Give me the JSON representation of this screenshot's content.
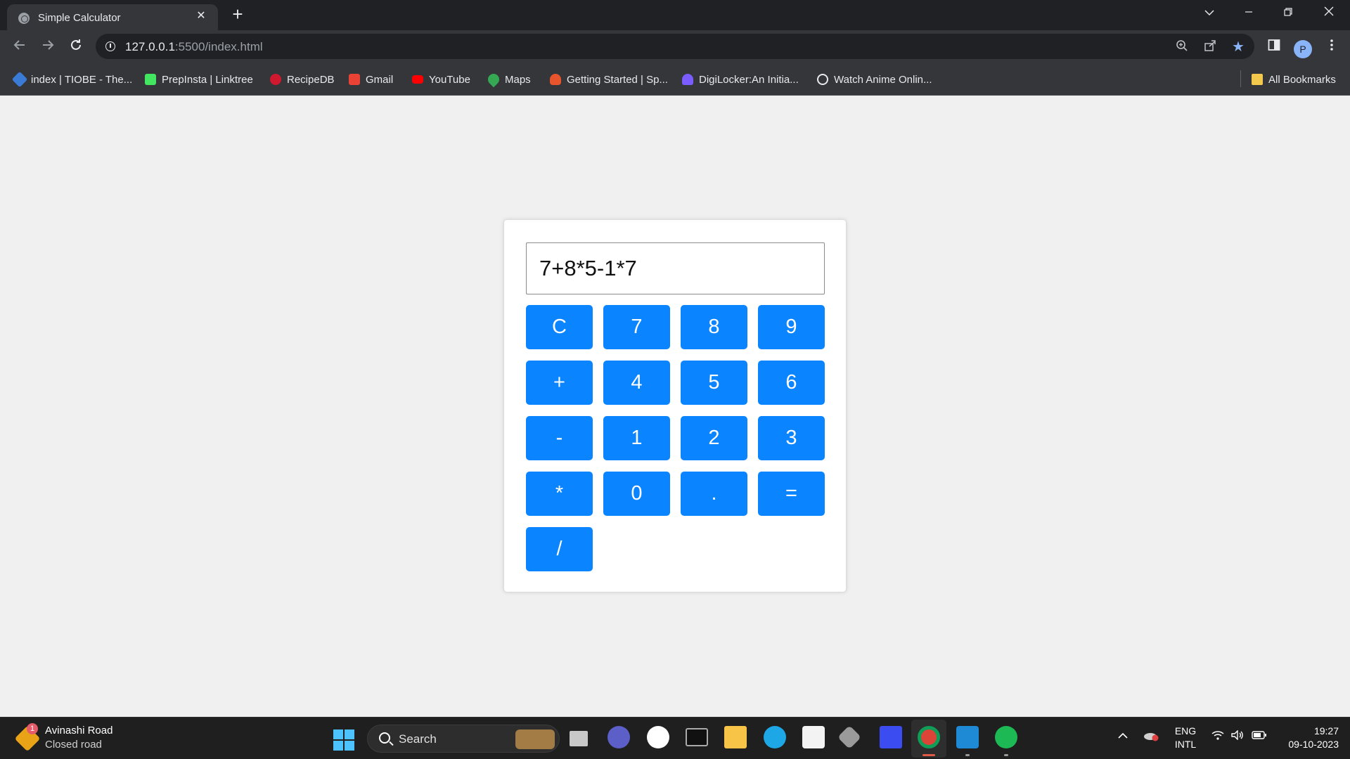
{
  "browser": {
    "tab_title": "Simple Calculator",
    "tab_close": "✕",
    "new_tab": "+",
    "url_host": "127.0.0.1",
    "url_path": ":5500/index.html",
    "profile_initial": "P"
  },
  "bookmarks": [
    {
      "label": "index | TIOBE - The...",
      "icon": "tiobe-icon",
      "color": "#3a7bd5"
    },
    {
      "label": "PrepInsta | Linktree",
      "icon": "linktree-icon",
      "color": "#43e660"
    },
    {
      "label": "RecipeDB",
      "icon": "recipedb-icon",
      "color": "#d0182e"
    },
    {
      "label": "Gmail",
      "icon": "gmail-icon",
      "color": "#ea4335"
    },
    {
      "label": "YouTube",
      "icon": "youtube-icon",
      "color": "#ff0000"
    },
    {
      "label": "Maps",
      "icon": "maps-icon",
      "color": "#34a853"
    },
    {
      "label": "Getting Started | Sp...",
      "icon": "spring-icon",
      "color": "#e8552c"
    },
    {
      "label": "DigiLocker:An Initia...",
      "icon": "digilocker-icon",
      "color": "#7a5cff"
    },
    {
      "label": "Watch Anime Onlin...",
      "icon": "anime-icon",
      "color": "#e8eaed"
    }
  ],
  "all_bookmarks": "All Bookmarks",
  "calculator": {
    "display_value": "7+8*5-1*7",
    "keys": [
      "C",
      "7",
      "8",
      "9",
      "+",
      "4",
      "5",
      "6",
      "-",
      "1",
      "2",
      "3",
      "*",
      "0",
      ".",
      "=",
      "/"
    ],
    "accent_color": "#0a84ff"
  },
  "taskbar": {
    "weather_badge": "1",
    "weather_title": "Avinashi Road",
    "weather_subtitle": "Closed road",
    "search_label": "Search",
    "lang_line1": "ENG",
    "lang_line2": "INTL",
    "time": "19:27",
    "date": "09-10-2023",
    "apps": [
      "task-view",
      "teams",
      "messenger",
      "terminal",
      "file-explorer",
      "edge",
      "microsoft-store",
      "unity",
      "jetbrains-toolbox",
      "chrome",
      "vscode",
      "spotify"
    ]
  }
}
